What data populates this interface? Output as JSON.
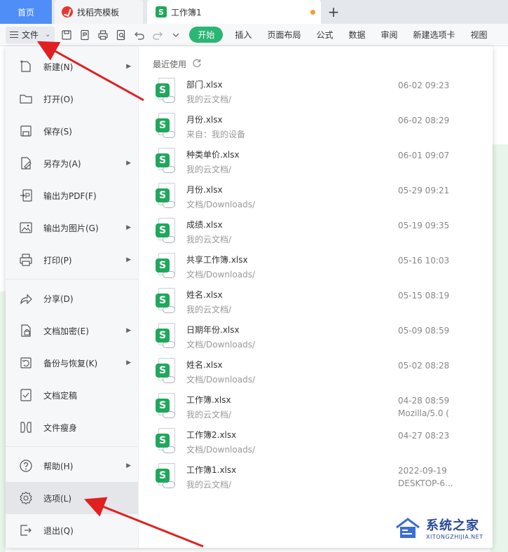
{
  "tabs": {
    "home": "首页",
    "template": "找稻壳模板",
    "document": "工作簿1",
    "add_symbol": "+"
  },
  "toolbar": {
    "file_label": "文件",
    "ribbon_tabs": [
      "开始",
      "插入",
      "页面布局",
      "公式",
      "数据",
      "审阅",
      "新建选项卡",
      "视图"
    ]
  },
  "file_menu": {
    "items": [
      {
        "label": "新建(N)",
        "icon": "new-file-icon",
        "submenu": true
      },
      {
        "label": "打开(O)",
        "icon": "folder-open-icon",
        "submenu": false
      },
      {
        "label": "保存(S)",
        "icon": "save-icon",
        "submenu": false
      },
      {
        "label": "另存为(A)",
        "icon": "save-as-icon",
        "submenu": true
      },
      {
        "label": "输出为PDF(F)",
        "icon": "export-pdf-icon",
        "submenu": false
      },
      {
        "label": "输出为图片(G)",
        "icon": "export-image-icon",
        "submenu": true
      },
      {
        "label": "打印(P)",
        "icon": "print-icon",
        "submenu": true
      },
      {
        "label": "分享(D)",
        "icon": "share-icon",
        "submenu": false
      },
      {
        "label": "文档加密(E)",
        "icon": "encrypt-icon",
        "submenu": true
      },
      {
        "label": "备份与恢复(K)",
        "icon": "backup-icon",
        "submenu": true
      },
      {
        "label": "文档定稿",
        "icon": "finalize-icon",
        "submenu": false
      },
      {
        "label": "文件瘦身",
        "icon": "slim-icon",
        "submenu": false
      },
      {
        "label": "帮助(H)",
        "icon": "help-icon",
        "submenu": true
      },
      {
        "label": "选项(L)",
        "icon": "gear-icon",
        "submenu": false
      },
      {
        "label": "退出(Q)",
        "icon": "exit-icon",
        "submenu": false
      }
    ]
  },
  "recent": {
    "title": "最近使用",
    "files": [
      {
        "name": "部门.xlsx",
        "path": "我的云文档/",
        "date": "06-02 09:23",
        "extra": ""
      },
      {
        "name": "月份.xlsx",
        "path": "来自：我的设备",
        "date": "06-02 08:29",
        "extra": ""
      },
      {
        "name": "种类单价.xlsx",
        "path": "我的云文档/",
        "date": "06-01 09:07",
        "extra": ""
      },
      {
        "name": "月份.xlsx",
        "path": "文档/Downloads/",
        "date": "05-29 09:21",
        "extra": ""
      },
      {
        "name": "成绩.xlsx",
        "path": "我的云文档/",
        "date": "05-19 09:35",
        "extra": ""
      },
      {
        "name": "共享工作簿.xlsx",
        "path": "文档/Downloads/",
        "date": "05-16 10:03",
        "extra": ""
      },
      {
        "name": "姓名.xlsx",
        "path": "我的云文档/",
        "date": "05-15 08:19",
        "extra": ""
      },
      {
        "name": "日期年份.xlsx",
        "path": "文档/Downloads/",
        "date": "05-09 08:59",
        "extra": ""
      },
      {
        "name": "姓名.xlsx",
        "path": "文档/Downloads/",
        "date": "05-02 08:28",
        "extra": ""
      },
      {
        "name": "工作簿.xlsx",
        "path": "我的云文档/",
        "date": "04-28 08:59",
        "extra": "Mozilla/5.0 ("
      },
      {
        "name": "工作簿2.xlsx",
        "path": "文档/Downloads/",
        "date": "04-27 08:23",
        "extra": ""
      },
      {
        "name": "工作簿1.xlsx",
        "path": "我的云文档/",
        "date": "2022-09-19",
        "extra": "DESKTOP-6..."
      }
    ]
  },
  "watermark": {
    "cn": "系统之家",
    "en": "XITONGZHIJIA.NET"
  },
  "colors": {
    "accent_green": "#2bb673",
    "home_tab_blue": "#4f8ef7",
    "annotation_red": "#e02020"
  }
}
